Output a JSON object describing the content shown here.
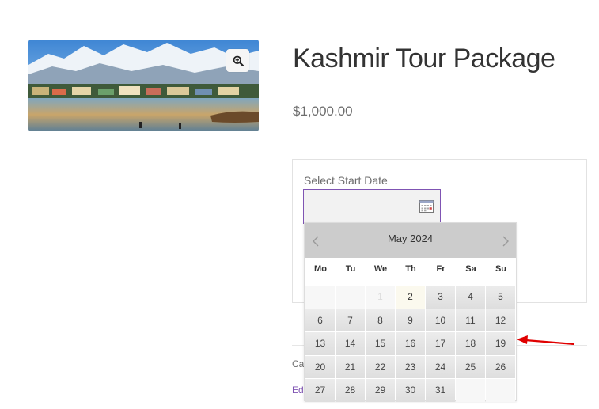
{
  "product": {
    "title": "Kashmir Tour Package",
    "price": "$1,000.00"
  },
  "booking": {
    "start_date_label": "Select Start Date",
    "start_date_value": ""
  },
  "meta": {
    "category_fragment": "Cat",
    "edit_fragment": "Edi"
  },
  "datepicker": {
    "month_title": "May 2024",
    "weekdays": [
      "Mo",
      "Tu",
      "We",
      "Th",
      "Fr",
      "Sa",
      "Su"
    ],
    "days": [
      {
        "label": "",
        "state": "empty"
      },
      {
        "label": "",
        "state": "empty"
      },
      {
        "label": "1",
        "state": "disabled"
      },
      {
        "label": "2",
        "state": "today"
      },
      {
        "label": "3",
        "state": "available"
      },
      {
        "label": "4",
        "state": "available"
      },
      {
        "label": "5",
        "state": "available"
      },
      {
        "label": "6",
        "state": "available"
      },
      {
        "label": "7",
        "state": "available"
      },
      {
        "label": "8",
        "state": "available"
      },
      {
        "label": "9",
        "state": "available"
      },
      {
        "label": "10",
        "state": "available"
      },
      {
        "label": "11",
        "state": "available"
      },
      {
        "label": "12",
        "state": "available"
      },
      {
        "label": "13",
        "state": "available"
      },
      {
        "label": "14",
        "state": "available"
      },
      {
        "label": "15",
        "state": "available"
      },
      {
        "label": "16",
        "state": "available"
      },
      {
        "label": "17",
        "state": "available"
      },
      {
        "label": "18",
        "state": "available"
      },
      {
        "label": "19",
        "state": "available"
      },
      {
        "label": "20",
        "state": "available"
      },
      {
        "label": "21",
        "state": "available"
      },
      {
        "label": "22",
        "state": "available"
      },
      {
        "label": "23",
        "state": "available"
      },
      {
        "label": "24",
        "state": "available"
      },
      {
        "label": "25",
        "state": "available"
      },
      {
        "label": "26",
        "state": "available"
      },
      {
        "label": "27",
        "state": "available"
      },
      {
        "label": "28",
        "state": "available"
      },
      {
        "label": "29",
        "state": "available"
      },
      {
        "label": "30",
        "state": "available"
      },
      {
        "label": "31",
        "state": "available"
      },
      {
        "label": "",
        "state": "empty"
      },
      {
        "label": "",
        "state": "empty"
      }
    ]
  },
  "icons": {
    "zoom": "magnifier-plus-icon",
    "calendar": "calendar-icon",
    "prev": "chevron-left-icon",
    "next": "chevron-right-icon",
    "annotation": "red-arrow-icon"
  },
  "colors": {
    "accent": "#7f54b3",
    "datepicker_header": "#cccccc",
    "annotation_arrow": "#e00000"
  }
}
